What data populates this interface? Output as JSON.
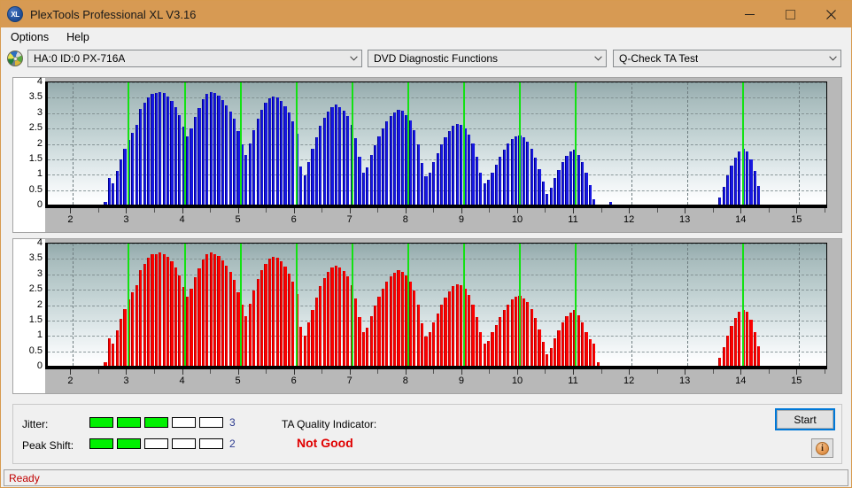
{
  "window": {
    "title": "PlexTools Professional XL V3.16",
    "icon": "xl-app-icon",
    "controls": {
      "minimize": "minimize-icon",
      "maximize": "maximize-icon",
      "close": "close-icon"
    }
  },
  "menu": {
    "items": [
      {
        "label": "Options"
      },
      {
        "label": "Help"
      }
    ]
  },
  "toolbar": {
    "disc_icon": "disc-icon",
    "drive_select": {
      "value": "HA:0 ID:0  PX-716A",
      "options": [
        "HA:0 ID:0  PX-716A"
      ]
    },
    "function_select": {
      "value": "DVD Diagnostic Functions",
      "options": [
        "DVD Diagnostic Functions"
      ]
    },
    "test_select": {
      "value": "Q-Check TA Test",
      "options": [
        "Q-Check TA Test"
      ]
    }
  },
  "indicators": {
    "jitter_label": "Jitter:",
    "jitter_value": "3",
    "jitter_filled": 3,
    "jitter_total": 5,
    "peak_shift_label": "Peak Shift:",
    "peak_shift_value": "2",
    "peak_shift_filled": 2,
    "peak_shift_total": 5,
    "ta_label": "TA Quality Indicator:",
    "ta_value": "Not Good",
    "ta_color": "#e00000",
    "meter_on_color": "#00f000"
  },
  "actions": {
    "start_label": "Start",
    "info_label": "i"
  },
  "status": {
    "text": "Ready",
    "color": "#c00000"
  },
  "chart_data": [
    {
      "id": "ta-test-blue",
      "type": "bar",
      "title": "",
      "xlabel": "",
      "ylabel": "",
      "series_color": "#1818e0",
      "xlim": [
        1.55,
        15.55
      ],
      "ylim": [
        0,
        4
      ],
      "yticks": [
        0,
        0.5,
        1,
        1.5,
        2,
        2.5,
        3,
        3.5,
        4
      ],
      "ytick_labels": [
        "0",
        "0.5",
        "1",
        "1.5",
        "2",
        "2.5",
        "3",
        "3.5",
        "4"
      ],
      "xticks": [
        2,
        3,
        4,
        5,
        6,
        7,
        8,
        9,
        10,
        11,
        12,
        13,
        14,
        15
      ],
      "xtick_labels": [
        "2",
        "3",
        "4",
        "5",
        "6",
        "7",
        "8",
        "9",
        "10",
        "11",
        "12",
        "13",
        "14",
        "15"
      ],
      "grid": true,
      "marker_lines": [
        3,
        4,
        5,
        6,
        7,
        8,
        9,
        10,
        11,
        14
      ],
      "marker_color": "#13e113",
      "x": [
        2.58,
        2.65,
        2.72,
        2.79,
        2.86,
        2.93,
        3.0,
        3.07,
        3.14,
        3.21,
        3.28,
        3.35,
        3.42,
        3.49,
        3.56,
        3.63,
        3.7,
        3.77,
        3.84,
        3.91,
        3.98,
        4.05,
        4.12,
        4.19,
        4.26,
        4.33,
        4.4,
        4.47,
        4.54,
        4.61,
        4.68,
        4.75,
        4.82,
        4.89,
        4.96,
        5.03,
        5.1,
        5.17,
        5.24,
        5.31,
        5.38,
        5.45,
        5.52,
        5.59,
        5.66,
        5.73,
        5.8,
        5.87,
        5.94,
        6.01,
        6.08,
        6.15,
        6.22,
        6.29,
        6.36,
        6.43,
        6.5,
        6.57,
        6.64,
        6.71,
        6.78,
        6.85,
        6.92,
        6.99,
        7.06,
        7.13,
        7.2,
        7.27,
        7.34,
        7.41,
        7.48,
        7.55,
        7.62,
        7.69,
        7.76,
        7.83,
        7.9,
        7.97,
        8.04,
        8.11,
        8.18,
        8.25,
        8.32,
        8.39,
        8.46,
        8.53,
        8.6,
        8.67,
        8.74,
        8.81,
        8.88,
        8.95,
        9.02,
        9.09,
        9.16,
        9.23,
        9.3,
        9.37,
        9.44,
        9.51,
        9.58,
        9.65,
        9.72,
        9.79,
        9.86,
        9.93,
        10.0,
        10.07,
        10.14,
        10.21,
        10.28,
        10.35,
        10.42,
        10.49,
        10.56,
        10.63,
        10.7,
        10.77,
        10.84,
        10.91,
        10.98,
        11.05,
        11.12,
        11.19,
        11.26,
        11.33,
        11.62,
        13.58,
        13.65,
        13.72,
        13.79,
        13.86,
        13.93,
        14.0,
        14.07,
        14.14,
        14.21,
        14.28
      ],
      "values": [
        0.1,
        0.85,
        0.68,
        1.1,
        1.48,
        1.8,
        2.1,
        2.32,
        2.58,
        3.1,
        3.3,
        3.48,
        3.6,
        3.62,
        3.66,
        3.62,
        3.52,
        3.38,
        3.18,
        2.92,
        2.52,
        2.22,
        2.48,
        2.85,
        3.15,
        3.42,
        3.6,
        3.66,
        3.62,
        3.54,
        3.4,
        3.22,
        3.02,
        2.78,
        2.38,
        1.95,
        1.6,
        2.0,
        2.42,
        2.8,
        3.08,
        3.3,
        3.46,
        3.52,
        3.48,
        3.38,
        3.2,
        2.98,
        2.7,
        2.3,
        1.25,
        0.95,
        1.38,
        1.8,
        2.2,
        2.55,
        2.82,
        3.02,
        3.18,
        3.24,
        3.18,
        3.06,
        2.88,
        2.6,
        2.15,
        1.55,
        1.05,
        1.22,
        1.6,
        1.92,
        2.22,
        2.48,
        2.7,
        2.88,
        3.0,
        3.08,
        3.04,
        2.92,
        2.72,
        2.42,
        1.95,
        1.35,
        0.92,
        1.05,
        1.38,
        1.68,
        1.96,
        2.2,
        2.4,
        2.55,
        2.62,
        2.6,
        2.48,
        2.28,
        1.98,
        1.55,
        1.05,
        0.7,
        0.8,
        1.05,
        1.3,
        1.55,
        1.78,
        1.98,
        2.12,
        2.22,
        2.24,
        2.18,
        2.04,
        1.82,
        1.52,
        1.15,
        0.75,
        0.35,
        0.55,
        0.85,
        1.12,
        1.38,
        1.58,
        1.72,
        1.78,
        1.62,
        1.38,
        1.05,
        0.62,
        0.18,
        0.1,
        0.22,
        0.58,
        0.95,
        1.28,
        1.52,
        1.72,
        1.8,
        1.72,
        1.48,
        1.08,
        0.6,
        0.18
      ]
    },
    {
      "id": "ta-test-red",
      "type": "bar",
      "title": "",
      "xlabel": "",
      "ylabel": "",
      "series_color": "#fc0000",
      "xlim": [
        1.55,
        15.55
      ],
      "ylim": [
        0,
        4
      ],
      "yticks": [
        0,
        0.5,
        1,
        1.5,
        2,
        2.5,
        3,
        3.5,
        4
      ],
      "ytick_labels": [
        "0",
        "0.5",
        "1",
        "1.5",
        "2",
        "2.5",
        "3",
        "3.5",
        "4"
      ],
      "xticks": [
        2,
        3,
        4,
        5,
        6,
        7,
        8,
        9,
        10,
        11,
        12,
        13,
        14,
        15
      ],
      "xtick_labels": [
        "2",
        "3",
        "4",
        "5",
        "6",
        "7",
        "8",
        "9",
        "10",
        "11",
        "12",
        "13",
        "14",
        "15"
      ],
      "grid": true,
      "marker_lines": [
        3,
        4,
        5,
        6,
        7,
        8,
        9,
        10,
        11,
        14
      ],
      "marker_color": "#13e113",
      "x": [
        2.58,
        2.65,
        2.72,
        2.79,
        2.86,
        2.93,
        3.0,
        3.07,
        3.14,
        3.21,
        3.28,
        3.35,
        3.42,
        3.49,
        3.56,
        3.63,
        3.7,
        3.77,
        3.84,
        3.91,
        3.98,
        4.05,
        4.12,
        4.19,
        4.26,
        4.33,
        4.4,
        4.47,
        4.54,
        4.61,
        4.68,
        4.75,
        4.82,
        4.89,
        4.96,
        5.03,
        5.1,
        5.17,
        5.24,
        5.31,
        5.38,
        5.45,
        5.52,
        5.59,
        5.66,
        5.73,
        5.8,
        5.87,
        5.94,
        6.01,
        6.08,
        6.15,
        6.22,
        6.29,
        6.36,
        6.43,
        6.5,
        6.57,
        6.64,
        6.71,
        6.78,
        6.85,
        6.92,
        6.99,
        7.06,
        7.13,
        7.2,
        7.27,
        7.34,
        7.41,
        7.48,
        7.55,
        7.62,
        7.69,
        7.76,
        7.83,
        7.9,
        7.97,
        8.04,
        8.11,
        8.18,
        8.25,
        8.32,
        8.39,
        8.46,
        8.53,
        8.6,
        8.67,
        8.74,
        8.81,
        8.88,
        8.95,
        9.02,
        9.09,
        9.16,
        9.23,
        9.3,
        9.37,
        9.44,
        9.51,
        9.58,
        9.65,
        9.72,
        9.79,
        9.86,
        9.93,
        10.0,
        10.07,
        10.14,
        10.21,
        10.28,
        10.35,
        10.42,
        10.49,
        10.56,
        10.63,
        10.7,
        10.77,
        10.84,
        10.91,
        10.98,
        11.05,
        11.12,
        11.19,
        11.26,
        11.33,
        11.4,
        13.58,
        13.65,
        13.72,
        13.79,
        13.86,
        13.93,
        14.0,
        14.07,
        14.14,
        14.21,
        14.28
      ],
      "values": [
        0.12,
        0.9,
        0.72,
        1.15,
        1.52,
        1.85,
        2.15,
        2.38,
        2.62,
        3.12,
        3.32,
        3.5,
        3.62,
        3.64,
        3.68,
        3.64,
        3.54,
        3.4,
        3.2,
        2.94,
        2.55,
        2.25,
        2.5,
        2.88,
        3.18,
        3.45,
        3.62,
        3.68,
        3.64,
        3.56,
        3.42,
        3.24,
        3.04,
        2.8,
        2.4,
        1.98,
        1.62,
        2.02,
        2.45,
        2.82,
        3.1,
        3.32,
        3.48,
        3.54,
        3.5,
        3.4,
        3.22,
        3.0,
        2.72,
        2.32,
        1.28,
        0.98,
        1.4,
        1.82,
        2.22,
        2.58,
        2.85,
        3.05,
        3.2,
        3.26,
        3.2,
        3.08,
        2.9,
        2.62,
        2.18,
        1.58,
        1.08,
        1.25,
        1.62,
        1.95,
        2.25,
        2.5,
        2.72,
        2.9,
        3.02,
        3.1,
        3.06,
        2.94,
        2.74,
        2.45,
        1.98,
        1.38,
        0.95,
        1.08,
        1.4,
        1.7,
        1.98,
        2.22,
        2.42,
        2.58,
        2.65,
        2.62,
        2.5,
        2.3,
        2.0,
        1.58,
        1.08,
        0.72,
        0.82,
        1.08,
        1.32,
        1.58,
        1.8,
        2.0,
        2.15,
        2.25,
        2.26,
        2.2,
        2.06,
        1.85,
        1.55,
        1.18,
        0.78,
        0.38,
        0.58,
        0.88,
        1.15,
        1.4,
        1.6,
        1.74,
        1.8,
        1.65,
        1.4,
        1.08,
        0.85,
        0.72,
        0.12,
        0.25,
        0.6,
        0.98,
        1.3,
        1.55,
        1.75,
        1.82,
        1.75,
        1.5,
        1.1,
        0.62,
        0.2
      ]
    }
  ]
}
